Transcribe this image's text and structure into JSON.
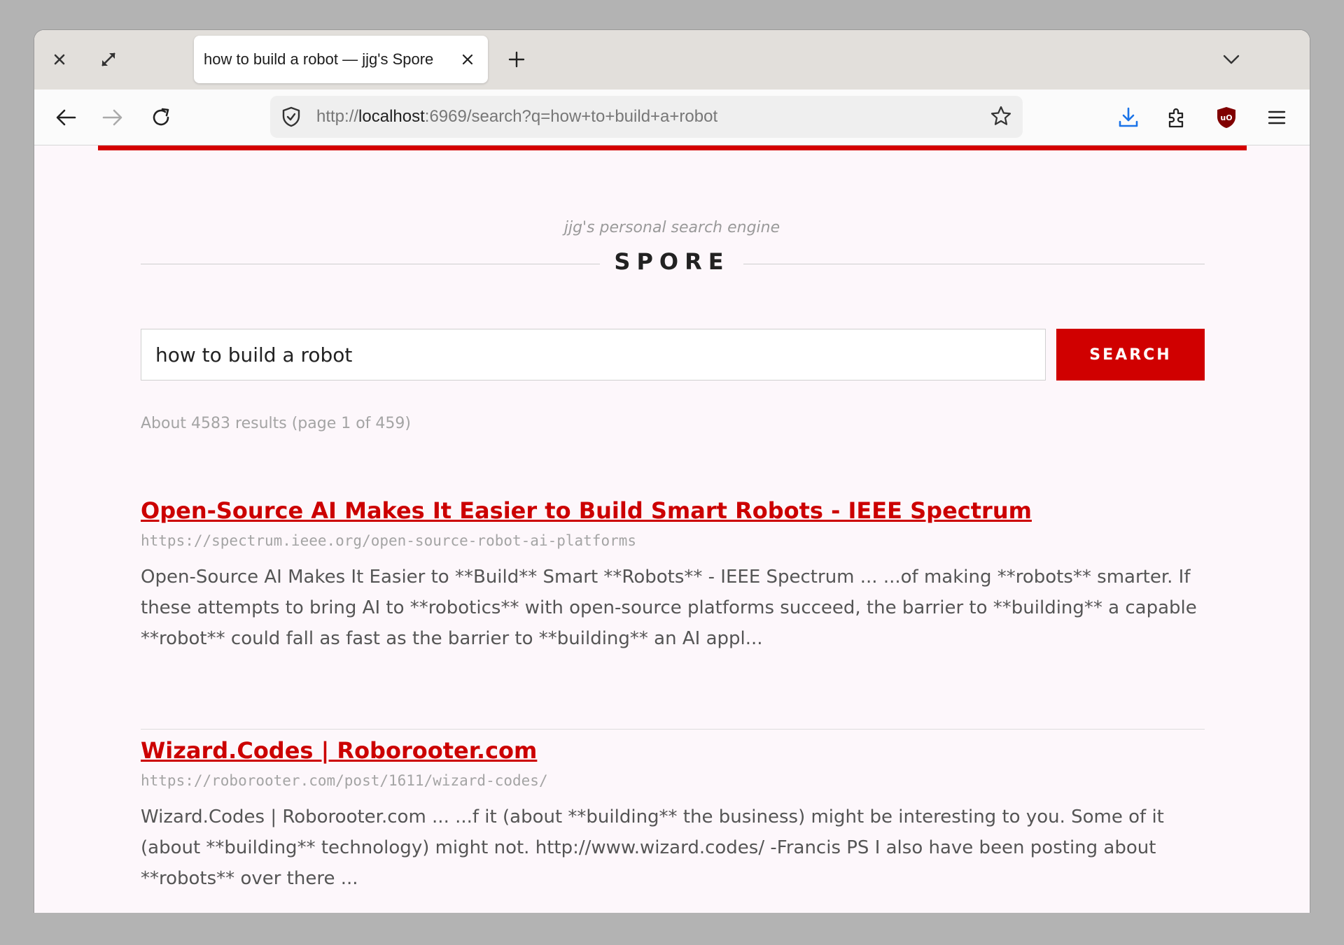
{
  "browser": {
    "tab_title": "how to build a robot — jjg's Spore",
    "url_prefix": "http://",
    "url_host": "localhost",
    "url_rest": ":6969/search?q=how+to+build+a+robot",
    "accent": "#d40000",
    "download_color": "#1a73e8"
  },
  "header": {
    "tagline": "jjg's personal search engine",
    "brand": "SPORE"
  },
  "search": {
    "value": "how to build a robot",
    "button_label": "SEARCH"
  },
  "results_info": "About 4583 results (page 1 of 459)",
  "results": [
    {
      "title": "Open-Source AI Makes It Easier to Build Smart Robots - IEEE Spectrum",
      "url": "https://spectrum.ieee.org/open-source-robot-ai-platforms",
      "snippet": "Open-Source AI Makes It Easier to **Build** Smart **Robots** - IEEE Spectrum ... ...of making **robots** smarter. If these attempts to bring AI to **robotics** with open-source platforms succeed, the barrier to **building** a capable **robot** could fall as fast as the barrier to **building** an AI appl..."
    },
    {
      "title": "Wizard.Codes | Roborooter.com",
      "url": "https://roborooter.com/post/1611/wizard-codes/",
      "snippet": "Wizard.Codes | Roborooter.com ... ...f it (about **building** the business) might be interesting to you. Some of it (about **building** technology) might not. http://www.wizard.codes/ -Francis PS I also have been posting about **robots** over there ..."
    }
  ]
}
